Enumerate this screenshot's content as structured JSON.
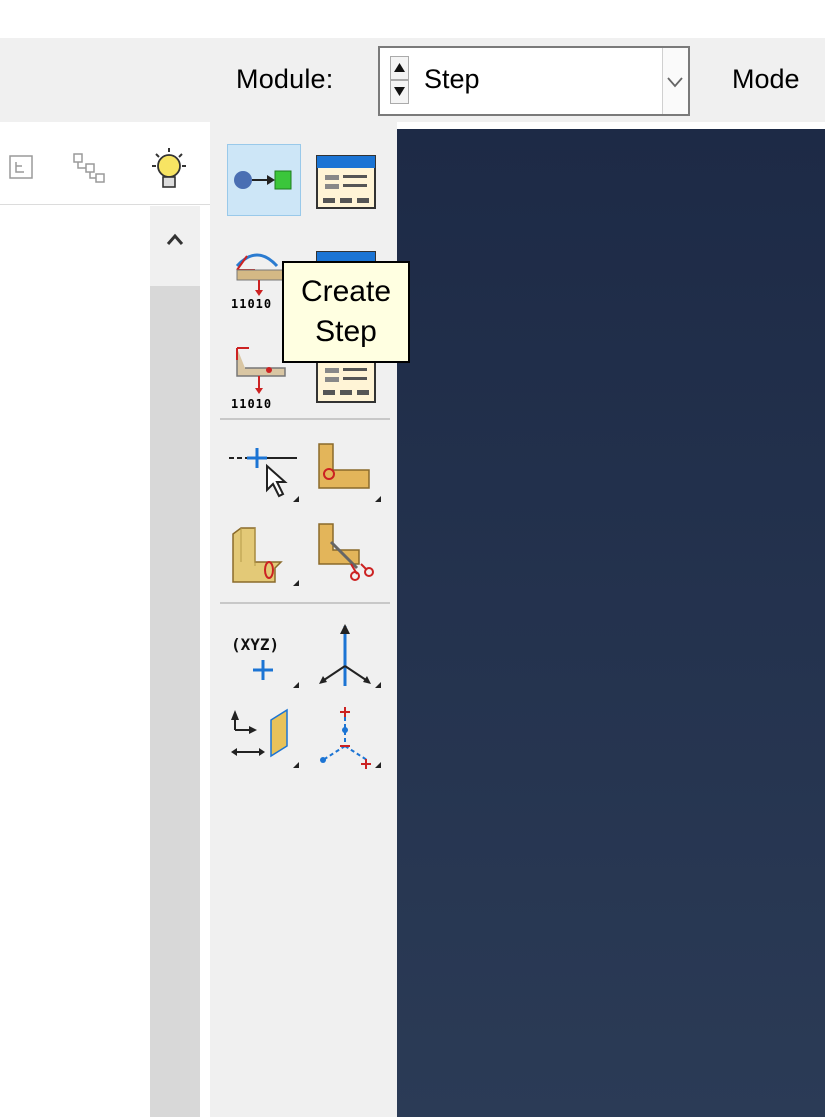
{
  "header": {
    "module_label": "Module:",
    "module_value": "Step",
    "model_label": "Mode"
  },
  "tree_toolbar": {
    "icons": [
      "model-tree-icon",
      "results-tree-icon",
      "lightbulb-icon"
    ]
  },
  "toolbox": {
    "tools": [
      "create-step-icon",
      "step-manager-icon",
      "field-output-request-icon",
      "field-output-manager-icon",
      "history-output-request-icon",
      "history-output-manager-icon",
      "partition-edge-icon",
      "partition-face-icon",
      "partition-cell-icon",
      "cut-part-icon",
      "datum-point-icon",
      "datum-axis-icon",
      "datum-plane-icon",
      "datum-csys-icon"
    ],
    "binary_label": "11010"
  },
  "tooltip": {
    "line1": "Create",
    "line2": "Step"
  },
  "colors": {
    "viewport_top": "#1d2a46",
    "viewport_bottom": "#2b3b56",
    "tooltip_bg": "#ffffe1",
    "active_tool_bg": "#cde6f7"
  }
}
